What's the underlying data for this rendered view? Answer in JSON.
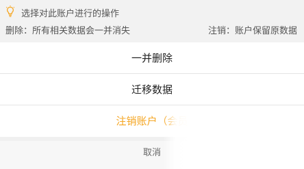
{
  "tip": {
    "icon": "lightbulb-icon",
    "title": "选择对此账户进行的操作",
    "delete_note": "删除：所有相关数据会一并消失",
    "cancel_note": "注销：账户保留原数据"
  },
  "actions": {
    "delete_all_label": "一并删除",
    "migrate_label": "迁移数据",
    "deregister_label": "注销账户（会员",
    "cancel_label": "取消"
  },
  "colors": {
    "accent_orange": "#f5a623",
    "background": "#f2f2f2",
    "sheet": "#ffffff"
  }
}
